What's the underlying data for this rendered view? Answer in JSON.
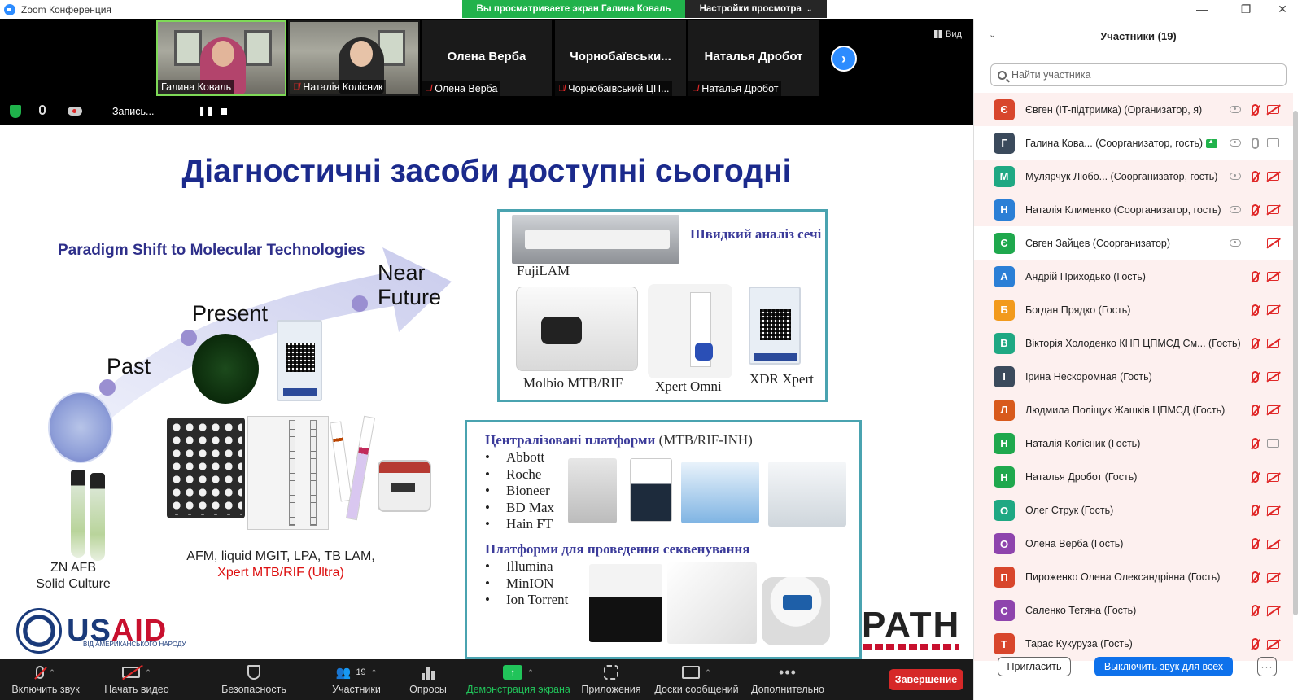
{
  "window": {
    "title": "Zoom Конференция"
  },
  "banner": {
    "viewing_text": "Вы просматриваете экран Галина Коваль",
    "view_options_label": "Настройки просмотра"
  },
  "meeting": {
    "view_label": "Вид",
    "tiles": [
      {
        "name": "Галина Коваль",
        "type": "video"
      },
      {
        "name": "Наталія Колісник",
        "type": "video",
        "muted": true
      },
      {
        "name": "Олена Верба",
        "big": "Олена Верба",
        "muted": true
      },
      {
        "name": "Чорнобаївський ЦП...",
        "big": "Чорнобаївськи...",
        "muted": true
      },
      {
        "name": "Наталья Дробот",
        "big": "Наталья Дробот",
        "muted": true
      }
    ],
    "recording_label": "Запись...",
    "pause_glyph": "❚❚"
  },
  "slide": {
    "title": "Діагностичні засоби доступні сьогодні",
    "paradigm": "Paradigm Shift to Molecular Technologies",
    "stages": {
      "past": "Past",
      "present": "Present",
      "near_future_1": "Near",
      "near_future_2": "Future"
    },
    "zn_afb": "ZN AFB",
    "solid_culture": "Solid Culture",
    "afm_line": "AFM, liquid MGIT, LPA, TB LAM,",
    "xpert_line": "Xpert MTB/RIF (Ultra)",
    "rapid_panel": {
      "title": "Швидкий аналіз сечі",
      "fujilam": "FujiLAM",
      "molbio": "Molbio MTB/RIF",
      "xpert_omni": "Xpert Omni",
      "xdr_xpert": "XDR Xpert"
    },
    "central_panel": {
      "title": "Централізовані платформи",
      "title_suffix": "(MTB/RIF-INH)",
      "items": [
        "Abbott",
        "Roche",
        "Bioneer",
        "BD Max",
        "Hain FT"
      ],
      "seq_title": "Платформи для проведення секвенування",
      "seq_items": [
        "Illumina",
        "MinION",
        "Ion Torrent"
      ]
    },
    "usaid": {
      "us": "US",
      "aid": "AID",
      "tag": "ВІД АМЕРИКАНСЬКОГО НАРОДУ"
    },
    "path_logo": "PATH"
  },
  "toolbar": {
    "unmute": "Включить звук",
    "start_video": "Начать видео",
    "security": "Безопасность",
    "participants": "Участники",
    "participants_count": "19",
    "polls": "Опросы",
    "share": "Демонстрация экрана",
    "apps": "Приложения",
    "boards": "Доски сообщений",
    "more": "Дополнительно",
    "end": "Завершение"
  },
  "participants_panel": {
    "title": "Участники (19)",
    "search_placeholder": "Найти участника",
    "participants": [
      {
        "initial": "Є",
        "color": "#d8462c",
        "name": "Євген (IT-підтримка) (Организатор, я)",
        "cloud": true,
        "mic": "muted",
        "cam": "muted",
        "hl": true
      },
      {
        "initial": "Г",
        "color": "#3b4a5c",
        "name": "Галина Кова... (Соорганизатор, гость)",
        "flag": true,
        "cloud": true,
        "mic": "on",
        "cam": "on",
        "hl": false
      },
      {
        "initial": "М",
        "color": "#1fa883",
        "name": "Мулярчук Любо... (Соорганизатор, гость)",
        "cloud": true,
        "mic": "muted",
        "cam": "muted",
        "hl": true
      },
      {
        "initial": "Н",
        "color": "#2b7fd6",
        "name": "Наталія Клименко (Соорганизатор, гость)",
        "cloud": true,
        "mic": "muted",
        "cam": "muted",
        "hl": true
      },
      {
        "initial": "Є",
        "color": "#1fa84d",
        "name": "Євген Зайцев (Соорганизатор)",
        "cloud": true,
        "mic": "none",
        "cam": "muted",
        "hl": false
      },
      {
        "initial": "А",
        "color": "#2b7fd6",
        "name": "Андрій Приходько (Гость)",
        "mic": "muted",
        "cam": "muted",
        "hl": true
      },
      {
        "initial": "Б",
        "color": "#f29a1c",
        "name": "Богдан Прядко (Гость)",
        "mic": "muted",
        "cam": "muted",
        "hl": true
      },
      {
        "initial": "В",
        "color": "#1fa883",
        "name": "Вікторія Холоденко КНП ЦПМСД См... (Гость)",
        "mic": "muted",
        "cam": "muted",
        "hl": true
      },
      {
        "initial": "І",
        "color": "#3b4a5c",
        "name": "Ірина Нескоромная (Гость)",
        "mic": "muted",
        "cam": "muted",
        "hl": true
      },
      {
        "initial": "Л",
        "color": "#d85a1c",
        "name": "Людмила Поліщук Жашків ЦПМСД (Гость)",
        "mic": "muted",
        "cam": "muted",
        "hl": true
      },
      {
        "initial": "Н",
        "color": "#1fa84d",
        "name": "Наталія Колісник (Гость)",
        "mic": "muted",
        "cam": "on",
        "hl": true
      },
      {
        "initial": "Н",
        "color": "#1fa84d",
        "name": "Наталья Дробот (Гость)",
        "mic": "muted",
        "cam": "muted",
        "hl": true
      },
      {
        "initial": "О",
        "color": "#1fa883",
        "name": "Олег Струк (Гость)",
        "mic": "muted",
        "cam": "muted",
        "hl": true
      },
      {
        "initial": "О",
        "color": "#8e44ad",
        "name": "Олена Верба (Гость)",
        "mic": "muted",
        "cam": "muted",
        "hl": true
      },
      {
        "initial": "П",
        "color": "#d8462c",
        "name": "Пироженко Олена Олександрівна (Гость)",
        "mic": "muted",
        "cam": "muted",
        "hl": true
      },
      {
        "initial": "С",
        "color": "#8e44ad",
        "name": "Саленко Тетяна (Гость)",
        "mic": "muted",
        "cam": "muted",
        "hl": true
      },
      {
        "initial": "Т",
        "color": "#d8462c",
        "name": "Тарас Кукуруза (Гость)",
        "mic": "muted",
        "cam": "muted",
        "hl": true
      }
    ],
    "invite": "Пригласить",
    "mute_all": "Выключить звук для всех",
    "more": "···"
  }
}
